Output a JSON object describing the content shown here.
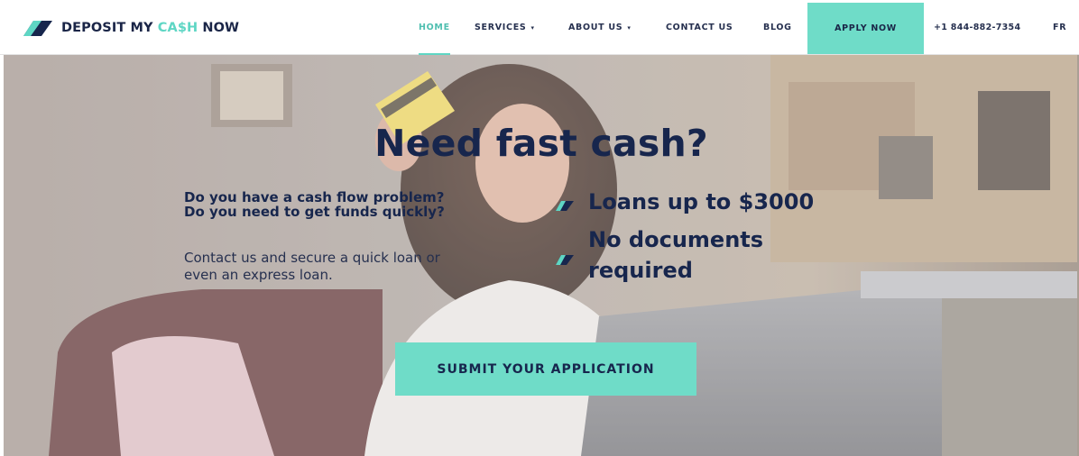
{
  "brand": {
    "name_part1": "DEPOSIT MY ",
    "name_accent": "CA$H",
    "name_part2": " NOW",
    "accent_color": "#5ed6c4",
    "primary_color": "#17264d"
  },
  "nav": {
    "items": [
      {
        "label": "HOME",
        "active": true
      },
      {
        "label": "SERVICES",
        "dropdown": true
      },
      {
        "label": "ABOUT US",
        "dropdown": true
      },
      {
        "label": "CONTACT US"
      },
      {
        "label": "BLOG"
      }
    ],
    "apply_label": "APPLY NOW",
    "phone": "+1 844-882-7354",
    "language": "FR"
  },
  "hero": {
    "headline": "Need fast cash?",
    "question_1": "Do you have a cash flow problem?",
    "question_2": "Do you need to get funds quickly?",
    "intro_line_1": "Contact us and secure a quick loan or",
    "intro_line_2": "even an express loan.",
    "feature_1": "Loans up to $3000",
    "feature_2_line_1": "No documents",
    "feature_2_line_2": "required",
    "cta_label": "SUBMIT YOUR APPLICATION"
  },
  "icons": {
    "logo": "logo-mark-icon",
    "feature_bullet": "check-mark-icon",
    "dropdown": "chevron-down-icon"
  }
}
